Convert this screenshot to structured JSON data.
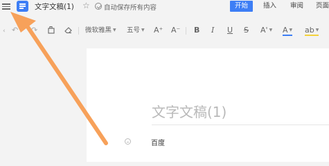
{
  "header": {
    "menu_icon": "hamburger-menu-icon",
    "doc_icon": "document-icon",
    "doc_title": "文字文稿(1)",
    "star_icon": "star-icon",
    "save_icon": "check-circle-icon",
    "autosave_text": "自动保存所有内容",
    "tabs": [
      {
        "label": "开始",
        "active": true
      },
      {
        "label": "插入",
        "active": false
      },
      {
        "label": "审阅",
        "active": false
      },
      {
        "label": "页面",
        "active": false
      }
    ],
    "accent_color": "#3d7ef5"
  },
  "toolbar": {
    "undo_icon": "undo-icon",
    "redo_icon": "redo-icon",
    "format_painter_icon": "format-painter-icon",
    "eraser_icon": "eraser-icon",
    "font_name": "微软雅黑",
    "font_size": "五号",
    "grow_font": "A⁺",
    "shrink_font": "A⁻",
    "bold": "B",
    "italic": "I",
    "underline": "U",
    "strikethrough": "S",
    "superscript": "A'",
    "font_color": "A",
    "highlight": "ab"
  },
  "document": {
    "heading": "文字文稿(1)",
    "body": "百度"
  },
  "overlay": {
    "arrow_color": "#f7a15a",
    "arrow_icon": "annotation-arrow"
  }
}
